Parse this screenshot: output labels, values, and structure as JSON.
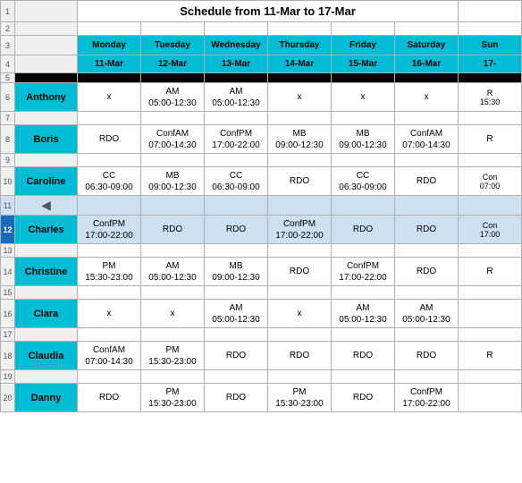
{
  "title": "Schedule from 11-Mar to 17-Mar",
  "headers": {
    "col_a": "",
    "monday": {
      "day": "Monday",
      "date": "11-Mar"
    },
    "tuesday": {
      "day": "Tuesday",
      "date": "12-Mar"
    },
    "wednesday": {
      "day": "Wednesday",
      "date": "13-Mar"
    },
    "thursday": {
      "day": "Thursday",
      "date": "14-Mar"
    },
    "friday": {
      "day": "Friday",
      "date": "15-Mar"
    },
    "saturday": {
      "day": "Saturday",
      "date": "16-Mar"
    },
    "sunday": {
      "day": "Sun",
      "date": "17-"
    }
  },
  "rows": [
    {
      "name": "Anthony",
      "mon": "x",
      "tue": "AM\n05:00-12:30",
      "wed": "AM\n05:00-12:30",
      "thu": "x",
      "fri": "x",
      "sat": "x",
      "sun": "R\n15:30"
    },
    {
      "name": "Boris",
      "mon": "RDO",
      "tue": "ConfAM\n07:00-14:30",
      "wed": "ConfPM\n17:00-22:00",
      "thu": "MB\n09:00-12:30",
      "fri": "MB\n09:00-12:30",
      "sat": "ConfAM\n07:00-14:30",
      "sun": "R"
    },
    {
      "name": "Caroline",
      "mon": "CC\n06:30-09:00",
      "tue": "MB\n09:00-12:30",
      "wed": "CC\n06:30-09:00",
      "thu": "RDO",
      "fri": "CC\n06:30-09:00",
      "sat": "RDO",
      "sun": "Con\n07:00"
    },
    {
      "name": "Charles",
      "mon": "ConfPM\n17:00-22:00",
      "tue": "RDO",
      "wed": "RDO",
      "thu": "ConfPM\n17:00-22:00",
      "fri": "RDO",
      "sat": "RDO",
      "sun": "Con\n17:00"
    },
    {
      "name": "Christine",
      "mon": "PM\n15:30-23:00",
      "tue": "AM\n05:00-12:30",
      "wed": "MB\n09:00-12:30",
      "thu": "RDO",
      "fri": "ConfPM\n17:00-22:00",
      "sat": "RDO",
      "sun": "R"
    },
    {
      "name": "Clara",
      "mon": "x",
      "tue": "x",
      "wed": "AM\n05:00-12:30",
      "thu": "x",
      "fri": "AM\n05:00-12:30",
      "sat": "AM\n05:00-12:30",
      "sun": ""
    },
    {
      "name": "Claudia",
      "mon": "ConfAM\n07:00-14:30",
      "tue": "PM\n15:30-23:00",
      "wed": "RDO",
      "thu": "RDO",
      "fri": "RDO",
      "sat": "RDO",
      "sun": "R"
    },
    {
      "name": "Danny",
      "mon": "RDO",
      "tue": "PM\n15:30-23:00",
      "wed": "RDO",
      "thu": "PM\n15:30-23:00",
      "fri": "RDO",
      "sat": "ConfPM\n17:00-22:00",
      "sun": ""
    }
  ],
  "row_numbers": {
    "title_row": "1",
    "empty1": "2",
    "header": "3",
    "date_row": "4",
    "black": "5",
    "anthony": "6",
    "empty_a": "7",
    "boris": "8",
    "empty_b": "9",
    "caroline": "10",
    "empty_c": "11",
    "charles": "12",
    "empty_d": "13",
    "christine": "14",
    "empty_e": "15",
    "clara": "16",
    "empty_f": "17",
    "claudia": "18",
    "empty_g": "19",
    "danny": "20"
  }
}
